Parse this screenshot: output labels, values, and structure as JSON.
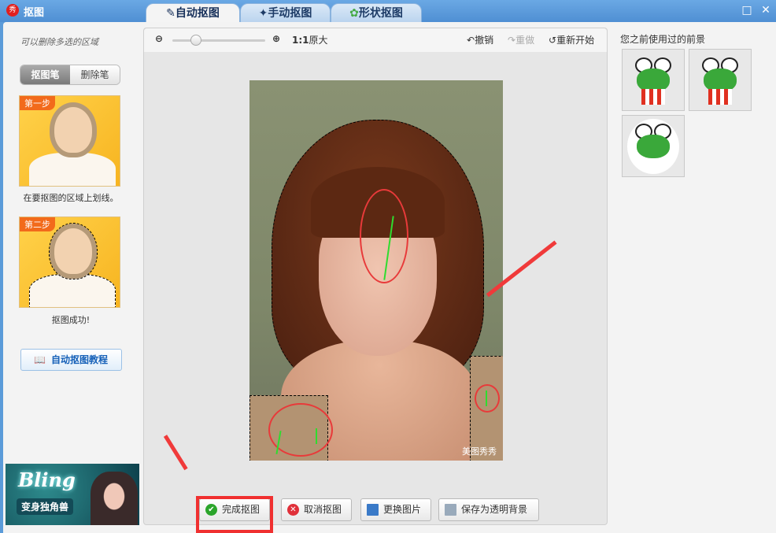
{
  "window": {
    "title": "抠图",
    "logo_text": "秀"
  },
  "tabs": [
    {
      "label": "自动抠图",
      "active": true
    },
    {
      "label": "手动抠图",
      "active": false
    },
    {
      "label": "形状抠图",
      "active": false
    }
  ],
  "left": {
    "hint": "可以删除多选的区域",
    "pens": [
      "抠图笔",
      "删除笔"
    ],
    "step1": {
      "badge": "第一步",
      "caption": "在要抠图的区域上划线。"
    },
    "step2": {
      "badge": "第二步",
      "caption": "抠图成功!"
    },
    "tutorial": "自动抠图教程",
    "ad": {
      "title": "Bling",
      "subtitle": "变身独角兽"
    }
  },
  "toolbar": {
    "zoom_label": "1:1",
    "original": "原大",
    "undo": "撤销",
    "redo": "重做",
    "restart": "重新开始",
    "zoom_fraction": 0.25
  },
  "photo": {
    "watermark": "美图秀秀"
  },
  "buttons": {
    "finish": "完成抠图",
    "cancel": "取消抠图",
    "replace": "更换图片",
    "save": "保存为透明背景"
  },
  "right": {
    "title": "您之前使用过的前景"
  }
}
